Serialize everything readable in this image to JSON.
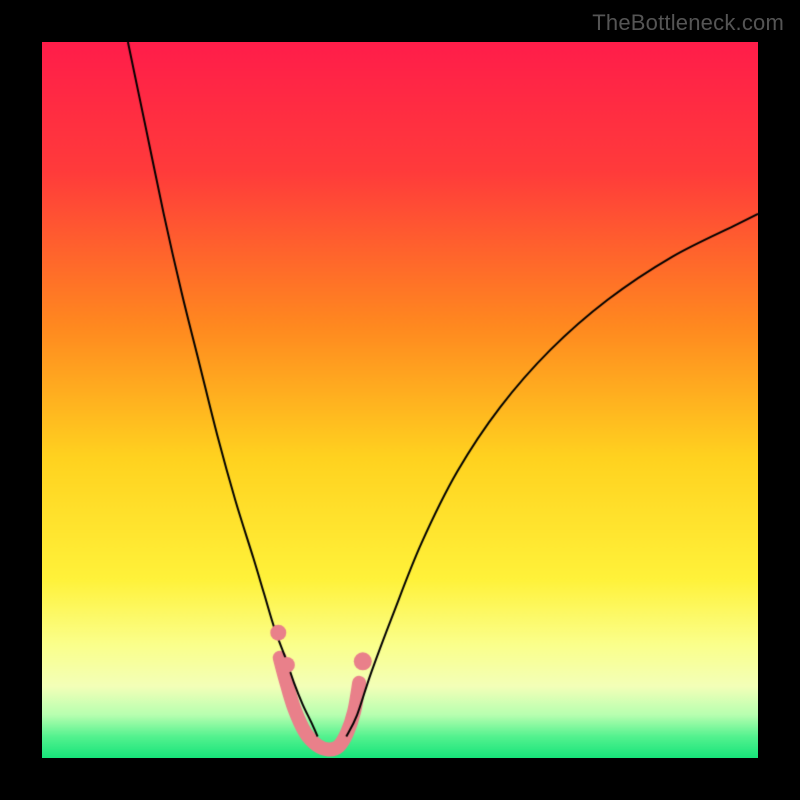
{
  "watermark": "TheBottleneck.com",
  "chart_data": {
    "type": "line",
    "title": "",
    "xlabel": "",
    "ylabel": "",
    "xlim": [
      0,
      100
    ],
    "ylim": [
      0,
      100
    ],
    "gradient_stops": [
      {
        "t": 0.0,
        "color": "#ff1d4a"
      },
      {
        "t": 0.18,
        "color": "#ff3b3b"
      },
      {
        "t": 0.4,
        "color": "#ff8a1f"
      },
      {
        "t": 0.58,
        "color": "#ffd21f"
      },
      {
        "t": 0.75,
        "color": "#fff23a"
      },
      {
        "t": 0.84,
        "color": "#fbff8a"
      },
      {
        "t": 0.9,
        "color": "#f3ffb8"
      },
      {
        "t": 0.94,
        "color": "#b7ffb0"
      },
      {
        "t": 0.97,
        "color": "#54f28f"
      },
      {
        "t": 1.0,
        "color": "#17e47a"
      }
    ],
    "series": [
      {
        "name": "left-curve",
        "color": "#000000",
        "width": 2,
        "x": [
          12.0,
          14.5,
          17.0,
          19.5,
          22.0,
          24.5,
          27.0,
          29.5,
          31.0,
          32.5,
          34.0,
          35.2,
          36.4,
          37.6,
          38.5
        ],
        "y": [
          100.0,
          88.0,
          76.0,
          65.0,
          55.0,
          45.0,
          36.0,
          28.0,
          23.0,
          18.0,
          14.0,
          10.5,
          7.5,
          5.0,
          3.0
        ]
      },
      {
        "name": "right-curve",
        "color": "#000000",
        "width": 2,
        "x": [
          42.5,
          44.0,
          46.0,
          49.0,
          53.0,
          58.0,
          64.0,
          71.0,
          79.0,
          88.0,
          97.0,
          100.0
        ],
        "y": [
          3.0,
          6.0,
          12.0,
          20.0,
          30.0,
          40.0,
          49.0,
          57.0,
          64.0,
          70.0,
          74.5,
          76.0
        ]
      },
      {
        "name": "valley-dots",
        "color": "#e9808a",
        "width": 14,
        "linecap": "round",
        "x": [
          33.2,
          34.0,
          35.2,
          36.8,
          38.4,
          40.0,
          41.4,
          42.6,
          43.6,
          44.3
        ],
        "y": [
          14.0,
          11.0,
          7.0,
          3.5,
          1.8,
          1.2,
          1.6,
          3.5,
          6.5,
          10.5
        ]
      }
    ],
    "extra_dots": [
      {
        "x": 33.0,
        "y": 17.5,
        "r": 8,
        "color": "#e9808a"
      },
      {
        "x": 34.2,
        "y": 13.0,
        "r": 8,
        "color": "#e9808a"
      },
      {
        "x": 44.8,
        "y": 13.5,
        "r": 9,
        "color": "#e9808a"
      }
    ]
  }
}
